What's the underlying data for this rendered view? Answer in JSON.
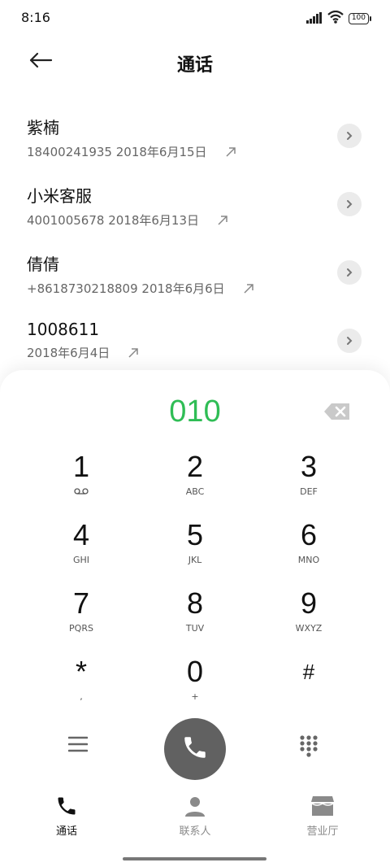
{
  "status_bar": {
    "time": "8:16",
    "battery": "100"
  },
  "header": {
    "title": "通话",
    "back_icon": "arrow-left-icon"
  },
  "calls": [
    {
      "name": "紫楠",
      "meta": "18400241935  2018年6月15日"
    },
    {
      "name": "小米客服",
      "meta": "4001005678  2018年6月13日"
    },
    {
      "name": "倩倩",
      "meta": "+8618730218809  2018年6月6日"
    },
    {
      "name": "1008611",
      "meta": "2018年6月4日"
    }
  ],
  "dialer": {
    "number": "010",
    "keys": [
      {
        "digit": "1",
        "sub": ""
      },
      {
        "digit": "2",
        "sub": "ABC"
      },
      {
        "digit": "3",
        "sub": "DEF"
      },
      {
        "digit": "4",
        "sub": "GHI"
      },
      {
        "digit": "5",
        "sub": "JKL"
      },
      {
        "digit": "6",
        "sub": "MNO"
      },
      {
        "digit": "7",
        "sub": "PQRS"
      },
      {
        "digit": "8",
        "sub": "TUV"
      },
      {
        "digit": "9",
        "sub": "WXYZ"
      },
      {
        "digit": "*",
        "sub": ","
      },
      {
        "digit": "0",
        "sub": "+"
      },
      {
        "digit": "#",
        "sub": ""
      }
    ]
  },
  "tabs": [
    {
      "label": "通话",
      "icon": "phone-icon"
    },
    {
      "label": "联系人",
      "icon": "person-icon"
    },
    {
      "label": "营业厅",
      "icon": "store-icon"
    }
  ],
  "colors": {
    "dial_number": "#2fbd55",
    "call_button": "#616161",
    "active_tab": "#111111",
    "inactive_tab": "#8a8a8a"
  }
}
